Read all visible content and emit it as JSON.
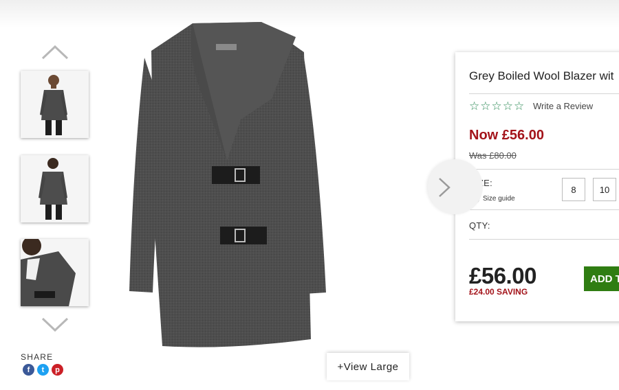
{
  "gallery": {
    "thumbnails": [
      "thumbnail-front",
      "thumbnail-back",
      "thumbnail-detail"
    ],
    "view_large_label": "+View Large"
  },
  "share": {
    "label": "SHARE",
    "icons": [
      "facebook-icon",
      "twitter-icon",
      "pinterest-icon"
    ]
  },
  "product": {
    "title": "Grey Boiled Wool Blazer wit",
    "rating_stars": 5,
    "write_review_label": "Write a Review",
    "now_price": "Now £56.00",
    "was_price": "Was £80.00",
    "size_label": "SIZE:",
    "size_guide_label": "Size guide",
    "sizes": [
      "8",
      "10"
    ],
    "qty_label": "QTY:",
    "big_price": "£56.00",
    "saving": "£24.00 SAVING",
    "add_button_label": "ADD T"
  },
  "colors": {
    "price_red": "#a3131a",
    "star_green": "#2e8b57",
    "add_green": "#2f7d12"
  }
}
